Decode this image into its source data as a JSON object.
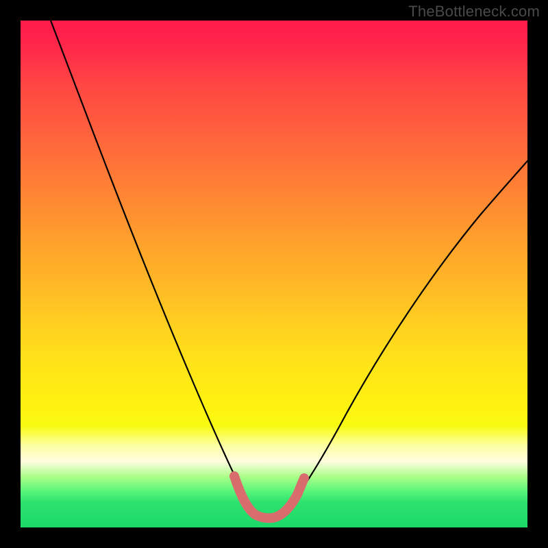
{
  "attribution": "TheBottleneck.com",
  "chart_data": {
    "type": "line",
    "title": "",
    "xlabel": "",
    "ylabel": "",
    "xlim": [
      0,
      100
    ],
    "ylim": [
      0,
      100
    ],
    "grid": false,
    "series": [
      {
        "name": "bottleneck-curve",
        "x": [
          6,
          10,
          14,
          18,
          22,
          26,
          30,
          33,
          36,
          39,
          41.5,
          44,
          46,
          48,
          50,
          52,
          55,
          58,
          62,
          66,
          70,
          75,
          80,
          85,
          90,
          95,
          100
        ],
        "y": [
          100,
          91,
          82,
          73,
          64,
          55,
          46,
          38,
          30,
          22,
          15,
          9,
          5,
          3,
          3,
          5,
          9,
          15,
          22,
          29,
          36,
          43,
          50,
          56,
          62,
          67,
          72
        ]
      },
      {
        "name": "optimal-highlight",
        "x": [
          42,
          44,
          46,
          48,
          50,
          52,
          54
        ],
        "y": [
          12,
          6,
          3,
          2,
          3,
          6,
          12
        ]
      }
    ],
    "gradient_stops": [
      {
        "pos": 0,
        "color": "#ff1a4a"
      },
      {
        "pos": 40,
        "color": "#ff8a32"
      },
      {
        "pos": 72,
        "color": "#ffe418"
      },
      {
        "pos": 87,
        "color": "#fffde0"
      },
      {
        "pos": 100,
        "color": "#1ad96a"
      }
    ]
  }
}
